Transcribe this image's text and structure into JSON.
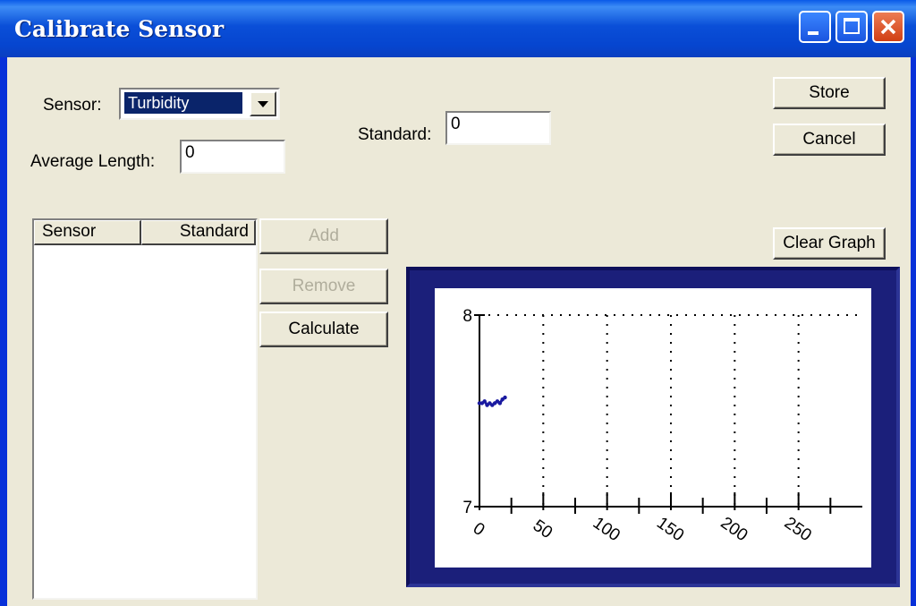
{
  "window": {
    "title": "Calibrate Sensor"
  },
  "title_buttons": {
    "minimize": "minimize-icon",
    "maximize": "maximize-icon",
    "close": "close-icon"
  },
  "form": {
    "sensor_label": "Sensor:",
    "sensor_value": "Turbidity",
    "average_length_label": "Average Length:",
    "average_length_value": "0",
    "standard_label": "Standard:",
    "standard_value": "0"
  },
  "buttons": {
    "store": "Store",
    "cancel": "Cancel",
    "clear_graph": "Clear Graph",
    "add": "Add",
    "remove": "Remove",
    "calculate": "Calculate"
  },
  "list": {
    "columns": [
      "Sensor",
      "Standard"
    ],
    "rows": []
  },
  "chart_data": {
    "type": "line",
    "title": "",
    "xlabel": "",
    "ylabel": "",
    "xlim": [
      0,
      300
    ],
    "ylim": [
      7,
      8
    ],
    "x_ticks": [
      0,
      50,
      100,
      150,
      200,
      250
    ],
    "y_ticks": [
      7,
      8
    ],
    "grid": "vertical dotted lines at x ticks, horizontal dotted line at y=8",
    "series": [
      {
        "color": "#1a1aa0",
        "x": [
          0,
          2,
          4,
          6,
          8,
          10,
          12,
          14,
          16,
          18,
          20
        ],
        "y": [
          7.54,
          7.54,
          7.55,
          7.53,
          7.54,
          7.53,
          7.54,
          7.55,
          7.54,
          7.56,
          7.57
        ]
      }
    ]
  },
  "colors": {
    "title_bar": "#0a4fd8",
    "dialog_bg": "#ece9d8",
    "graph_frame": "#1b1f7a",
    "selection": "#0a246a"
  }
}
